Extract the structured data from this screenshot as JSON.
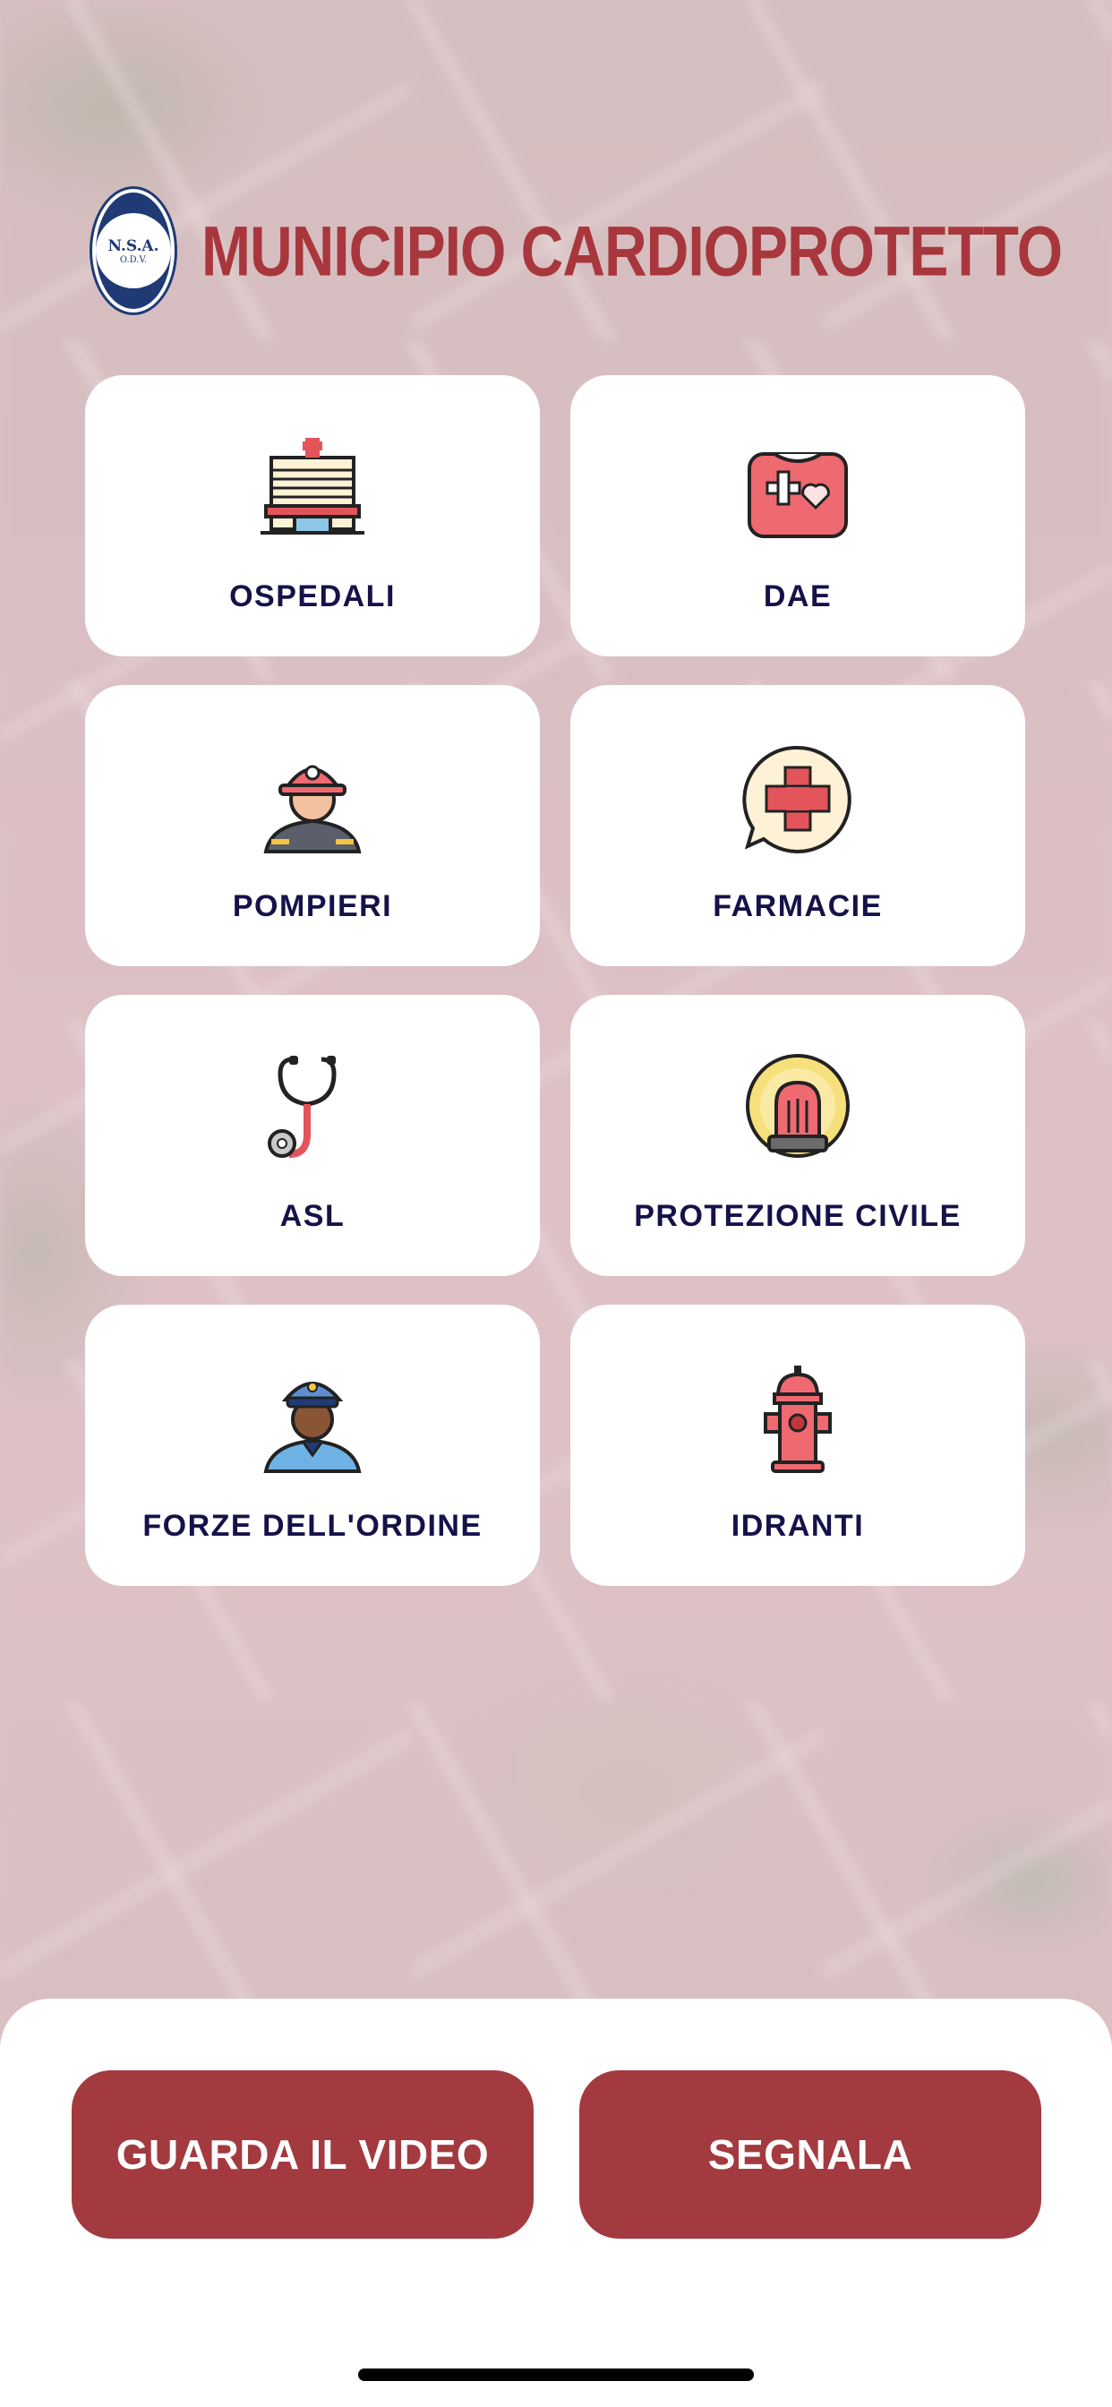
{
  "header": {
    "title": "MUNICIPIO  CARDIOPROTETTO",
    "logo_text": "N.S.A.",
    "logo_subtext": "O.D.V."
  },
  "cards": [
    {
      "label": "OSPEDALI",
      "icon": "hospital-icon"
    },
    {
      "label": "DAE",
      "icon": "first-aid-kit-icon"
    },
    {
      "label": "POMPIERI",
      "icon": "firefighter-icon"
    },
    {
      "label": "FARMACIE",
      "icon": "pharmacy-cross-icon"
    },
    {
      "label": "ASL",
      "icon": "stethoscope-icon"
    },
    {
      "label": "PROTEZIONE CIVILE",
      "icon": "siren-icon"
    },
    {
      "label": "FORZE DELL'ORDINE",
      "icon": "police-officer-icon"
    },
    {
      "label": "IDRANTI",
      "icon": "fire-hydrant-icon"
    }
  ],
  "actions": {
    "video_label": "GUARDA IL VIDEO",
    "report_label": "SEGNALA"
  },
  "colors": {
    "accent": "#a33a3f",
    "title": "#a8373d",
    "card_text": "#15124a"
  }
}
